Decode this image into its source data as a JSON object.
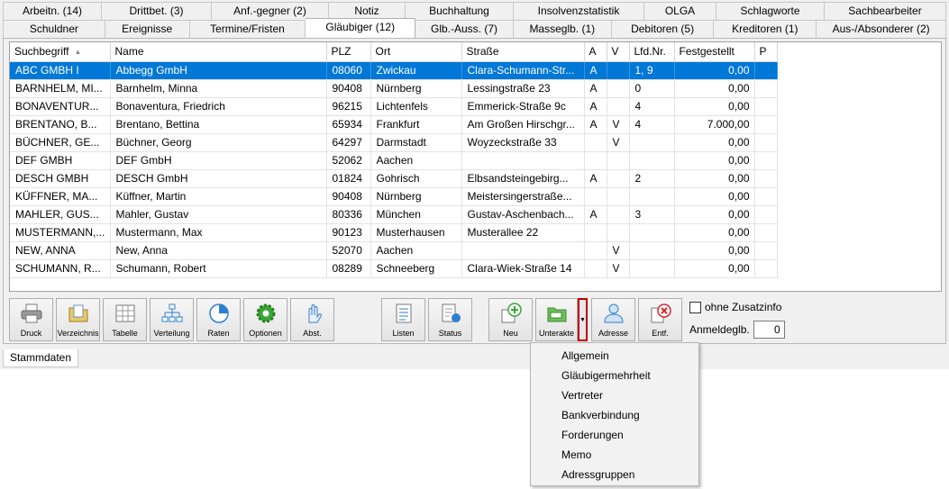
{
  "tabs_row1": [
    "Arbeitn. (14)",
    "Drittbet. (3)",
    "Anf.-gegner (2)",
    "Notiz",
    "Buchhaltung",
    "Insolvenzstatistik",
    "OLGA",
    "Schlagworte",
    "Sachbearbeiter"
  ],
  "tabs_row2": [
    "Schuldner",
    "Ereignisse",
    "Termine/Fristen",
    "Gläubiger (12)",
    "Glb.-Auss. (7)",
    "Masseglb. (1)",
    "Debitoren (5)",
    "Kreditoren (1)",
    "Aus-/Absonderer (2)"
  ],
  "active_tab": "Gläubiger (12)",
  "grid": {
    "columns": [
      "Suchbegriff",
      "Name",
      "PLZ",
      "Ort",
      "Straße",
      "A",
      "V",
      "Lfd.Nr.",
      "Festgestellt",
      "P"
    ],
    "sort_indicator": "▲",
    "rows": [
      [
        "ABC GMBH I",
        "Abbegg GmbH",
        "08060",
        "Zwickau",
        "Clara-Schumann-Str...",
        "A",
        "",
        "1, 9",
        "0,00",
        ""
      ],
      [
        "BARNHELM, MI...",
        "Barnhelm, Minna",
        "90408",
        "Nürnberg",
        "Lessingstraße 23",
        "A",
        "",
        "0",
        "0,00",
        ""
      ],
      [
        "BONAVENTUR...",
        "Bonaventura, Friedrich",
        "96215",
        "Lichtenfels",
        "Emmerick-Straße 9c",
        "A",
        "",
        "4",
        "0,00",
        ""
      ],
      [
        "BRENTANO, B...",
        "Brentano, Bettina",
        "65934",
        "Frankfurt",
        "Am Großen Hirschgr...",
        "A",
        "V",
        "4",
        "7.000,00",
        ""
      ],
      [
        "BÜCHNER, GE...",
        "Büchner, Georg",
        "64297",
        "Darmstadt",
        "Woyzeckstraße 33",
        "",
        "V",
        "",
        "0,00",
        ""
      ],
      [
        "DEF GMBH",
        "DEF GmbH",
        "52062",
        "Aachen",
        "",
        "",
        "",
        "",
        "0,00",
        ""
      ],
      [
        "DESCH GMBH",
        "DESCH GmbH",
        "01824",
        "Gohrisch",
        "Elbsandsteingebirg...",
        "A",
        "",
        "2",
        "0,00",
        ""
      ],
      [
        "KÜFFNER, MA...",
        "Küffner, Martin",
        "90408",
        "Nürnberg",
        "Meistersingerstraße...",
        "",
        "",
        "",
        "0,00",
        ""
      ],
      [
        "MAHLER, GUS...",
        "Mahler, Gustav",
        "80336",
        "München",
        "Gustav-Aschenbach...",
        "A",
        "",
        "3",
        "0,00",
        ""
      ],
      [
        "MUSTERMANN,...",
        "Mustermann, Max",
        "90123",
        "Musterhausen",
        "Musterallee 22",
        "",
        "",
        "",
        "0,00",
        ""
      ],
      [
        "NEW, ANNA",
        "New, Anna",
        "52070",
        "Aachen",
        "",
        "",
        "V",
        "",
        "0,00",
        ""
      ],
      [
        "SCHUMANN, R...",
        "Schumann, Robert",
        "08289",
        "Schneeberg",
        "Clara-Wiek-Straße 14",
        "",
        "V",
        "",
        "0,00",
        ""
      ]
    ]
  },
  "toolbar": {
    "druck": "Druck",
    "verzeichnis": "Verzeichnis",
    "tabelle": "Tabelle",
    "verteilung": "Verteilung",
    "raten": "Raten",
    "optionen": "Optionen",
    "abst": "Abst.",
    "listen": "Listen",
    "status": "Status",
    "neu": "Neu",
    "unterakte": "Unterakte",
    "adresse": "Adresse",
    "entf": "Entf."
  },
  "ohne_zusatzinfo": "ohne Zusatzinfo",
  "anmeldeglb_label": "Anmeldeglb.",
  "anmeldeglb_value": "0",
  "bottom_tab": "Stammdaten",
  "dropdown_menu": [
    "Allgemein",
    "Gläubigermehrheit",
    "Vertreter",
    "Bankverbindung",
    "Forderungen",
    "Memo",
    "Adressgruppen"
  ],
  "colors": {
    "selection": "#0078d7",
    "accent_green": "#3aa635",
    "accent_red": "#d9262b",
    "accent_blue": "#2f7fd0"
  }
}
